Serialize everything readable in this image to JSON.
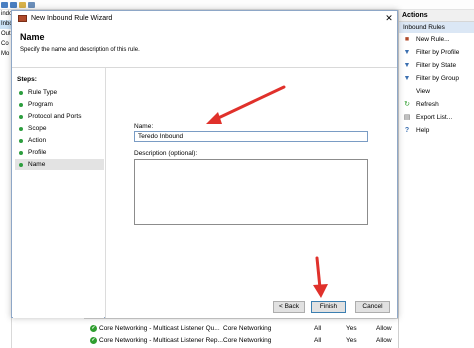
{
  "background": {
    "tree_items": [
      "indo",
      "Inbo",
      "Out",
      "Co",
      "Mo"
    ],
    "list_rows": [
      {
        "name": "Core Networking - Multicast Listener Qu...",
        "group": "Core Networking",
        "profile": "All",
        "enabled": "Yes",
        "action": "Allow"
      },
      {
        "name": "Core Networking - Multicast Listener Rep...",
        "group": "Core Networking",
        "profile": "All",
        "enabled": "Yes",
        "action": "Allow"
      }
    ]
  },
  "actions_pane": {
    "header": "Actions",
    "section": "Inbound Rules",
    "items": [
      {
        "label": "New Rule...",
        "icon": "new-rule-icon"
      },
      {
        "label": "Filter by Profile",
        "icon": "filter-icon"
      },
      {
        "label": "Filter by State",
        "icon": "filter-icon"
      },
      {
        "label": "Filter by Group",
        "icon": "filter-icon"
      },
      {
        "label": "View",
        "icon": ""
      },
      {
        "label": "Refresh",
        "icon": "refresh-icon"
      },
      {
        "label": "Export List...",
        "icon": "export-icon"
      },
      {
        "label": "Help",
        "icon": "help-icon"
      }
    ]
  },
  "wizard": {
    "title": "New Inbound Rule Wizard",
    "close_glyph": "✕",
    "header_title": "Name",
    "header_subtitle": "Specify the name and description of this rule.",
    "steps_label": "Steps:",
    "steps": [
      "Rule Type",
      "Program",
      "Protocol and Ports",
      "Scope",
      "Action",
      "Profile",
      "Name"
    ],
    "current_step": "Name",
    "name_label": "Name:",
    "name_value": "Teredo Inbound",
    "description_label": "Description (optional):",
    "description_value": "",
    "back_button": "< Back",
    "finish_button": "Finish",
    "cancel_button": "Cancel"
  },
  "colors": {
    "annotation_arrow": "#e0312b",
    "step_dot": "#2d9e3f",
    "selection": "#dbe7f5"
  }
}
